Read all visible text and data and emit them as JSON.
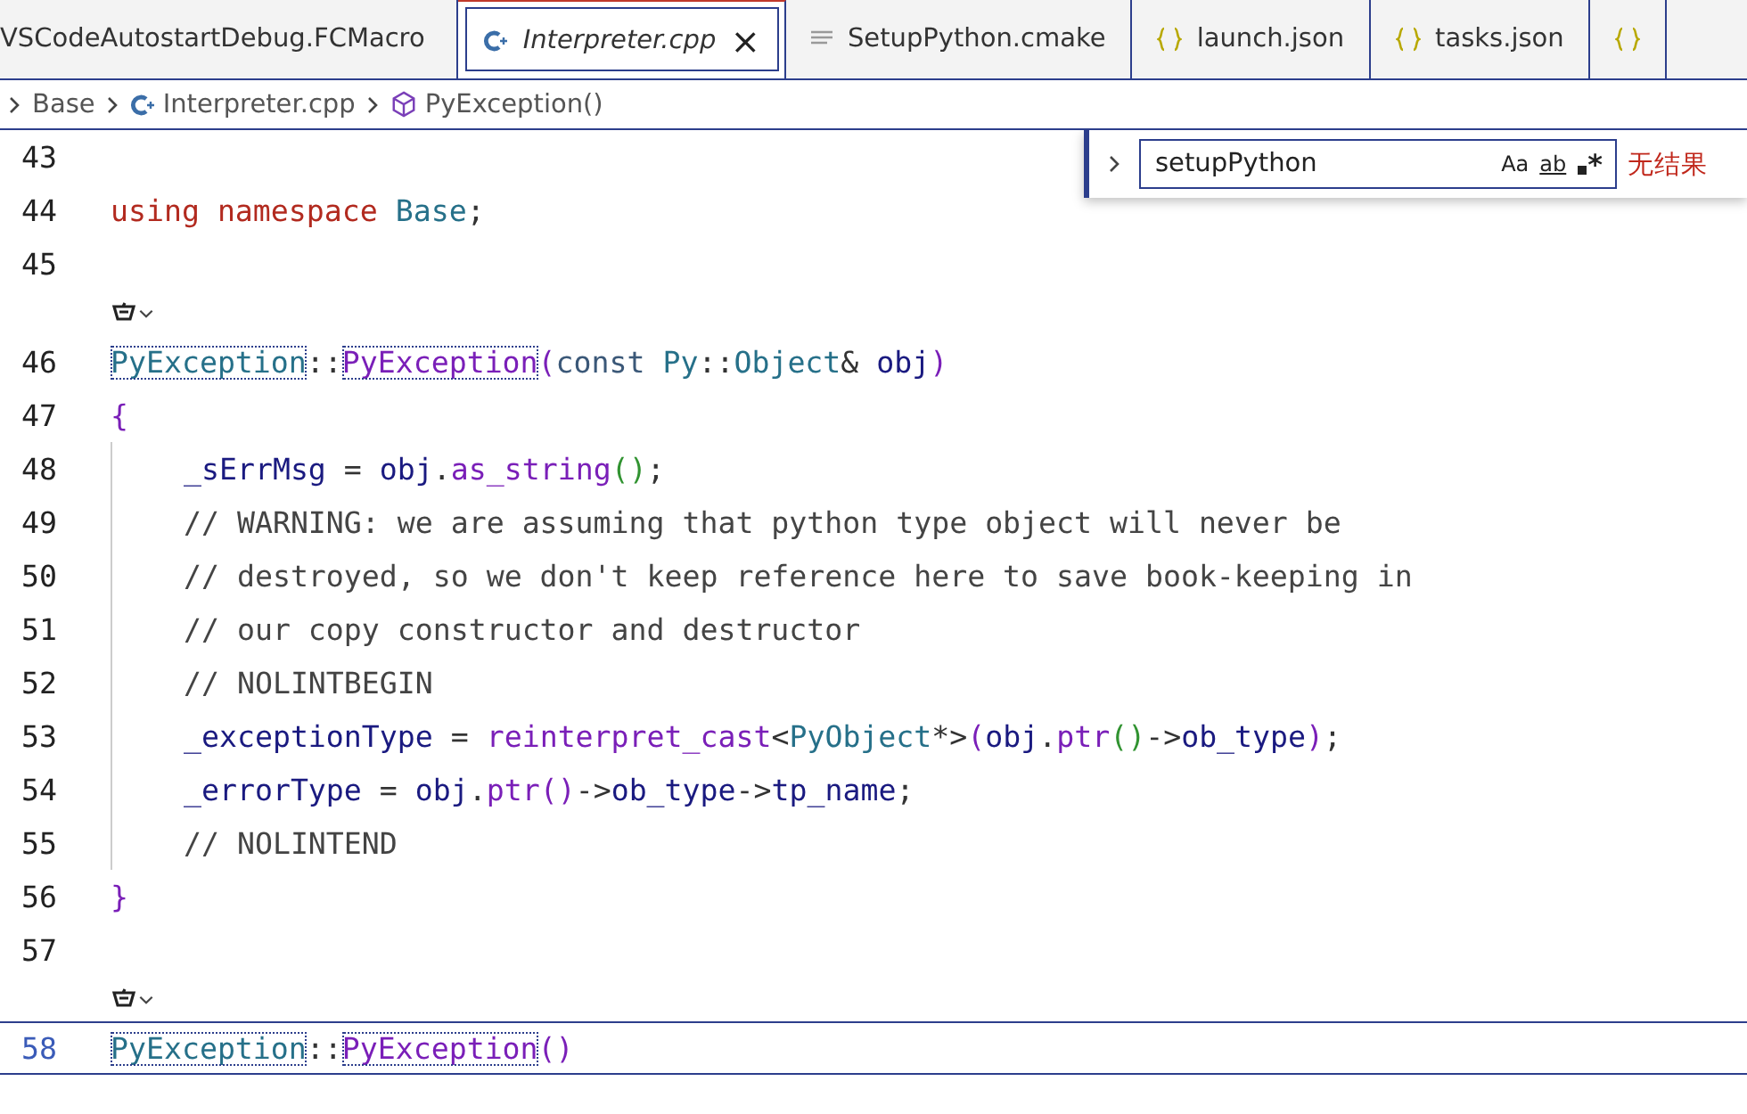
{
  "tabs": [
    {
      "label": "VSCodeAutostartDebug.FCMacro",
      "kind": "none",
      "selected": false,
      "preview": false
    },
    {
      "label": "Interpreter.cpp",
      "kind": "cpp",
      "selected": true,
      "preview": true,
      "close": "×"
    },
    {
      "label": "SetupPython.cmake",
      "kind": "cmake",
      "selected": false,
      "preview": false
    },
    {
      "label": "launch.json",
      "kind": "json",
      "selected": false,
      "preview": false
    },
    {
      "label": "tasks.json",
      "kind": "json",
      "selected": false,
      "preview": false
    },
    {
      "kind": "json",
      "selected": false,
      "preview": false
    }
  ],
  "breadcrumb": [
    {
      "label": "Base",
      "kind": "none"
    },
    {
      "label": "Interpreter.cpp",
      "kind": "cpp"
    },
    {
      "label": "PyException()",
      "kind": "symbol"
    }
  ],
  "find": {
    "value": "setupPython",
    "options": [
      "Aa",
      "ab",
      "*"
    ],
    "result": "无结果"
  },
  "lines": [
    {
      "kind": "code",
      "number": "43",
      "current": false
    },
    {
      "kind": "code",
      "number": "44",
      "current": false,
      "tokens": [
        {
          "text": "using",
          "kind": "keyword"
        },
        {
          "text": " namespace",
          "kind": "keyword"
        },
        {
          "text": " Base",
          "kind": "type"
        },
        {
          "text": ";",
          "kind": "plain"
        }
      ]
    },
    {
      "kind": "code",
      "number": "45",
      "current": false
    },
    {
      "kind": "codelens"
    },
    {
      "kind": "code",
      "number": "46",
      "current": false,
      "tokens": [
        {
          "text": "PyException",
          "kind": "type_hl"
        },
        {
          "text": "::",
          "kind": "plain"
        },
        {
          "text": "PyException",
          "kind": "function_hl"
        },
        {
          "text": "(",
          "kind": "bracket1"
        },
        {
          "text": "const",
          "kind": "keyword2"
        },
        {
          "text": " Py",
          "kind": "type"
        },
        {
          "text": "::",
          "kind": "plain"
        },
        {
          "text": "Object",
          "kind": "type"
        },
        {
          "text": "& ",
          "kind": "plain"
        },
        {
          "text": "obj",
          "kind": "variable"
        },
        {
          "text": ")",
          "kind": "bracket1"
        }
      ]
    },
    {
      "kind": "code",
      "number": "47",
      "current": false,
      "tokens": [
        {
          "text": "{",
          "kind": "bracket1"
        }
      ]
    },
    {
      "kind": "body",
      "number": "48",
      "current": false,
      "tokens": [
        {
          "text": "_sErrMsg",
          "kind": "variable"
        },
        {
          "text": " = ",
          "kind": "plain"
        },
        {
          "text": "obj",
          "kind": "variable"
        },
        {
          "text": ".",
          "kind": "plain"
        },
        {
          "text": "as_string",
          "kind": "function"
        },
        {
          "text": "()",
          "kind": "bracket2"
        },
        {
          "text": ";",
          "kind": "plain"
        }
      ]
    },
    {
      "kind": "body",
      "number": "49",
      "current": false,
      "tokens": [
        {
          "text": "// WARNING: we are assuming that python type object will never be",
          "kind": "comment"
        }
      ]
    },
    {
      "kind": "body",
      "number": "50",
      "current": false,
      "tokens": [
        {
          "text": "// destroyed, so we don't keep reference here to save book-keeping in",
          "kind": "comment"
        }
      ]
    },
    {
      "kind": "body",
      "number": "51",
      "current": false,
      "tokens": [
        {
          "text": "// our copy constructor and destructor",
          "kind": "comment"
        }
      ]
    },
    {
      "kind": "body",
      "number": "52",
      "current": false,
      "tokens": [
        {
          "text": "// NOLINTBEGIN",
          "kind": "comment"
        }
      ]
    },
    {
      "kind": "body",
      "number": "53",
      "current": false,
      "tokens": [
        {
          "text": "_exceptionType",
          "kind": "variable"
        },
        {
          "text": " = ",
          "kind": "plain"
        },
        {
          "text": "reinterpret_cast",
          "kind": "function"
        },
        {
          "text": "<",
          "kind": "plain"
        },
        {
          "text": "PyObject",
          "kind": "type"
        },
        {
          "text": "*>",
          "kind": "plain"
        },
        {
          "text": "(",
          "kind": "bracket1"
        },
        {
          "text": "obj",
          "kind": "variable"
        },
        {
          "text": ".",
          "kind": "plain"
        },
        {
          "text": "ptr",
          "kind": "function"
        },
        {
          "text": "()",
          "kind": "bracket2"
        },
        {
          "text": "->",
          "kind": "plain"
        },
        {
          "text": "ob_type",
          "kind": "variable"
        },
        {
          "text": ")",
          "kind": "bracket1"
        },
        {
          "text": ";",
          "kind": "plain"
        }
      ]
    },
    {
      "kind": "body",
      "number": "54",
      "current": false,
      "tokens": [
        {
          "text": "_errorType",
          "kind": "variable"
        },
        {
          "text": " = ",
          "kind": "plain"
        },
        {
          "text": "obj",
          "kind": "variable"
        },
        {
          "text": ".",
          "kind": "plain"
        },
        {
          "text": "ptr",
          "kind": "function"
        },
        {
          "text": "()",
          "kind": "bracket1"
        },
        {
          "text": "->",
          "kind": "plain"
        },
        {
          "text": "ob_type",
          "kind": "variable"
        },
        {
          "text": "->",
          "kind": "plain"
        },
        {
          "text": "tp_name",
          "kind": "variable"
        },
        {
          "text": ";",
          "kind": "plain"
        }
      ]
    },
    {
      "kind": "body",
      "number": "55",
      "current": false,
      "tokens": [
        {
          "text": "// NOLINTEND",
          "kind": "comment"
        }
      ]
    },
    {
      "kind": "code",
      "number": "56",
      "current": false,
      "tokens": [
        {
          "text": "}",
          "kind": "bracket1"
        }
      ]
    },
    {
      "kind": "code",
      "number": "57",
      "current": false
    },
    {
      "kind": "codelens"
    },
    {
      "kind": "code",
      "number": "58",
      "current": true,
      "tokens": [
        {
          "text": "PyException",
          "kind": "type_hl"
        },
        {
          "text": "::",
          "kind": "plain"
        },
        {
          "text": "PyException",
          "kind": "function_hl"
        },
        {
          "text": "()",
          "kind": "bracket1"
        }
      ]
    }
  ]
}
